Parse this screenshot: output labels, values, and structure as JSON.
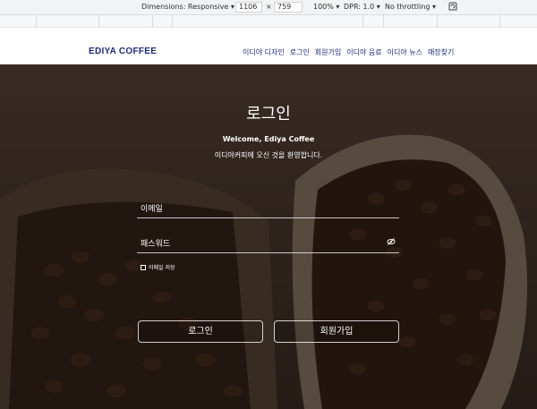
{
  "devtools": {
    "dimensions_label": "Dimensions: Responsive ▾",
    "width": "1106",
    "times": "×",
    "height": "759",
    "zoom": "100% ▾",
    "dpr": "DPR: 1.0 ▾",
    "throttling": "No throttling ▾"
  },
  "header": {
    "logo": "EDIYA COFFEE",
    "nav": [
      "이디야 디자인",
      "로그인",
      "회원가입",
      "이디야 음료",
      "이디야 뉴스",
      "매장찾기"
    ]
  },
  "login": {
    "title": "로그인",
    "welcome": "Welcome, Ediya Coffee",
    "subtitle": "이디야커피에 오신 것을 환영합니다.",
    "email_label": "이메일",
    "password_label": "패스워드",
    "remember_label": "이메일 저장",
    "login_button": "로그인",
    "signup_button": "회원가입"
  }
}
